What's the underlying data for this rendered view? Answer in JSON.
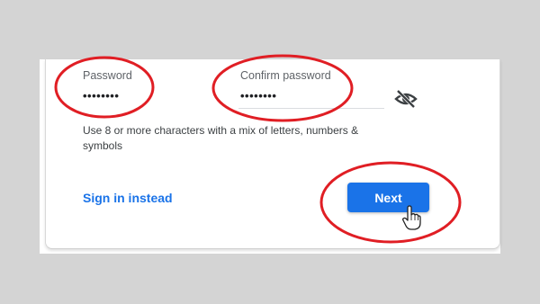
{
  "form": {
    "password": {
      "label": "Password",
      "value": "••••••••"
    },
    "confirm_password": {
      "label": "Confirm password",
      "value": "••••••••"
    },
    "hint": "Use 8 or more characters with a mix of letters, numbers & symbols",
    "sign_in_label": "Sign in instead",
    "next_label": "Next"
  },
  "icons": {
    "visibility_toggle": "eye-off-icon",
    "cursor": "hand-pointer-icon"
  },
  "colors": {
    "accent": "#1a73e8",
    "annotation": "#e01e24"
  }
}
